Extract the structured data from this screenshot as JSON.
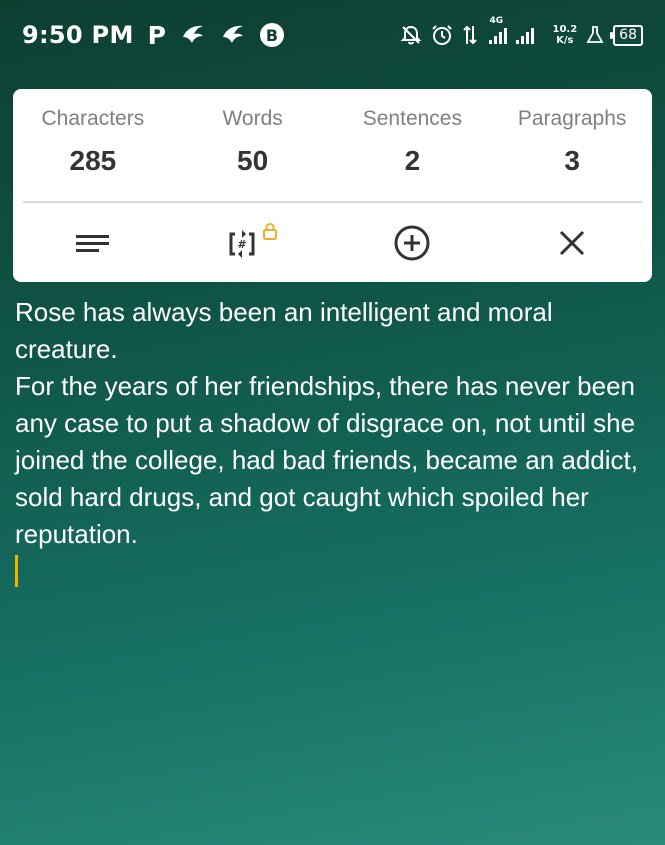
{
  "status_bar": {
    "time": "9:50 PM",
    "p_icon_text": "P",
    "b_icon_text": "B",
    "network": "4G",
    "net_speed_value": "10.2",
    "net_speed_unit": "K/s",
    "battery": "68"
  },
  "counter": {
    "stats": [
      {
        "label": "Characters",
        "value": "285"
      },
      {
        "label": "Words",
        "value": "50"
      },
      {
        "label": "Sentences",
        "value": "2"
      },
      {
        "label": "Paragraphs",
        "value": "3"
      }
    ],
    "toolbar_icons": [
      "menu-lines-icon",
      "counter-toggle-locked-icon",
      "add-circle-icon",
      "close-icon"
    ],
    "lock_color": "#f2b01e"
  },
  "editor": {
    "paragraphs": [
      "Rose has always been an intelligent and moral creature.",
      "For the years of her friendships, there has never been any case to put a shadow of disgrace on, not until she joined the college, had bad friends, became an addict, sold hard drugs, and got caught which spoiled her reputation."
    ],
    "caret_color": "#f0b400"
  }
}
